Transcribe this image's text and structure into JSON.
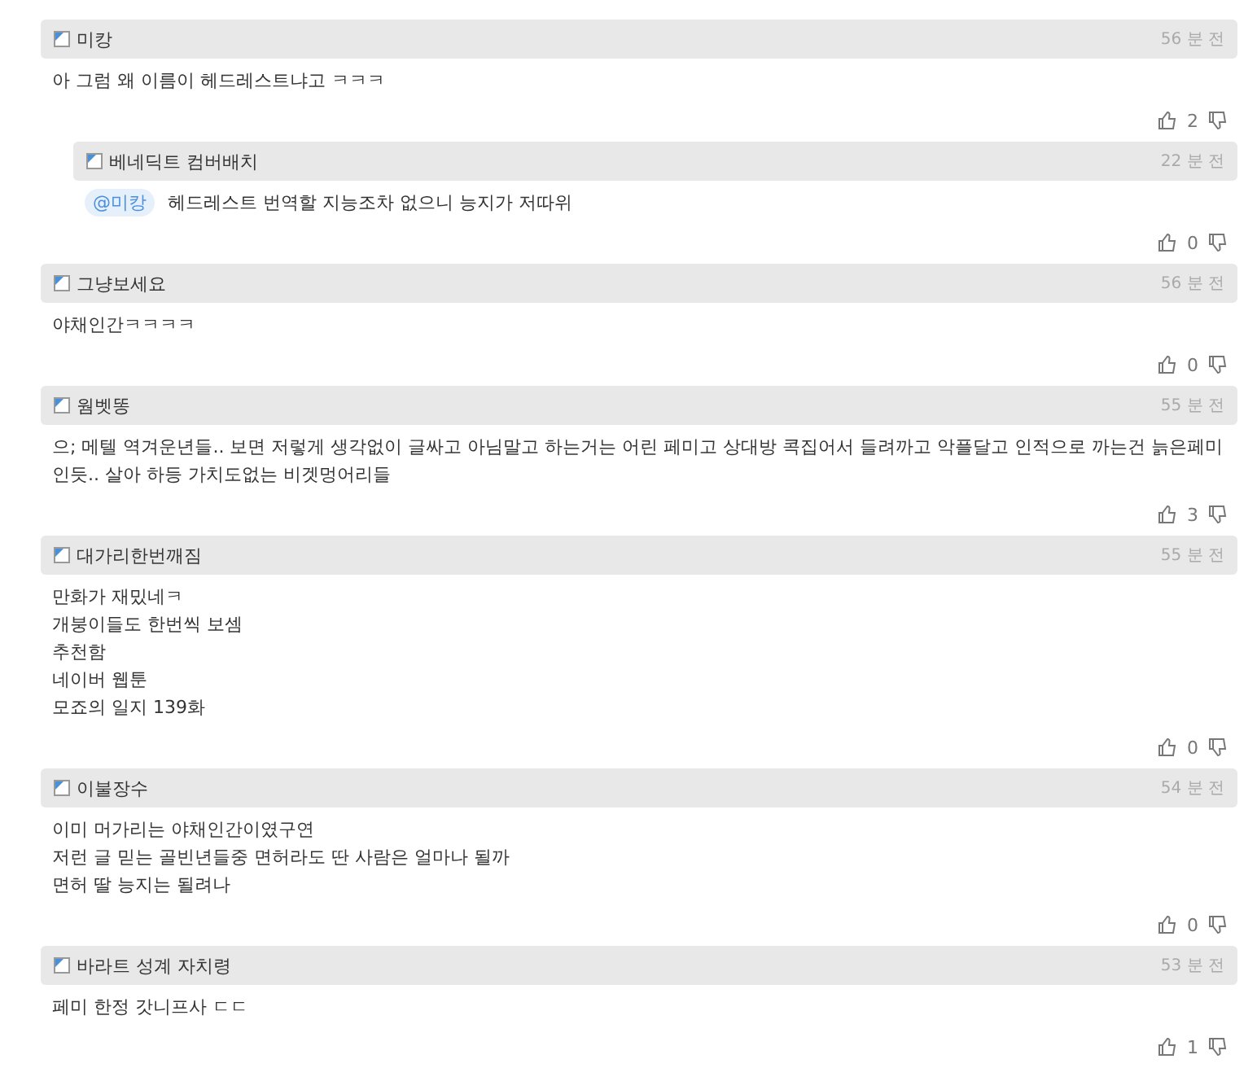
{
  "comments": [
    {
      "user": "미캉",
      "time": "56 분 전",
      "lines": [
        "아 그럼 왜 이름이 헤드레스트냐고 ㅋㅋㅋ"
      ],
      "likes": "2",
      "children": [
        {
          "user": "베네딕트 컴버배치",
          "time": "22 분 전",
          "mention": "@미캉",
          "lines": [
            "헤드레스트 번역할 지능조차 없으니 능지가 저따위"
          ],
          "likes": "0"
        }
      ]
    },
    {
      "user": "그냥보세요",
      "time": "56 분 전",
      "lines": [
        "야채인간ㅋㅋㅋㅋ"
      ],
      "likes": "0"
    },
    {
      "user": "웜벳똥",
      "time": "55 분 전",
      "lines": [
        "으; 메텔 역겨운년들.. 보면 저렇게 생각없이 글싸고 아님말고 하는거는 어린 페미고 상대방 콕집어서 들려까고 악플달고 인적으로 까는건 늙은페미 인듯.. 살아 하등 가치도없는 비겟멍어리들"
      ],
      "likes": "3"
    },
    {
      "user": "대가리한번깨짐",
      "time": "55 분 전",
      "lines": [
        "만화가 재밌네ㅋ",
        "개붕이들도 한번씩 보셈",
        "추천함",
        "네이버 웹툰",
        "모죠의 일지 139화"
      ],
      "likes": "0"
    },
    {
      "user": "이불장수",
      "time": "54 분 전",
      "lines": [
        "이미 머가리는 야채인간이였구연",
        "저런 글 믿는 골빈년들중 면허라도 딴 사람은 얼마나 될까",
        "면허 딸 능지는 될려나"
      ],
      "likes": "0"
    },
    {
      "user": "바라트 성계 자치령",
      "time": "53 분 전",
      "lines": [
        "페미 한정 갓니프사 ㄷㄷ"
      ],
      "likes": "1"
    }
  ]
}
